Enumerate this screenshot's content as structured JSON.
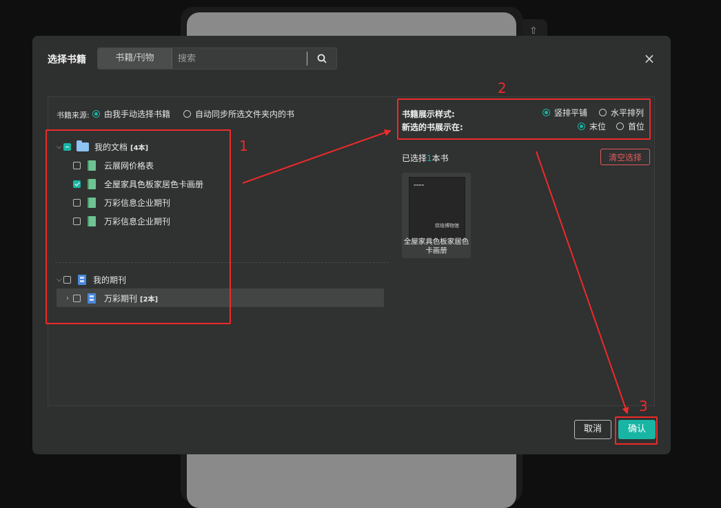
{
  "dialog": {
    "title": "选择书籍",
    "search_type": "书籍/刊物",
    "search_placeholder": "搜索",
    "search_icon": "search-icon",
    "close_icon": "close-icon"
  },
  "source": {
    "label": "书籍来源:",
    "options": [
      "由我手动选择书籍",
      "自动同步所选文件夹内的书"
    ],
    "selected": 0
  },
  "tree": {
    "docs_folder": {
      "label": "我的文档",
      "count": "[4本]"
    },
    "docs": [
      {
        "label": "云展网价格表",
        "checked": false
      },
      {
        "label": "全屋家具色板家居色卡画册",
        "checked": true
      },
      {
        "label": "万彩信息企业期刊",
        "checked": false
      },
      {
        "label": "万彩信息企业期刊",
        "checked": false
      }
    ],
    "periodicals_folder": {
      "label": "我的期刊"
    },
    "periodical": {
      "label": "万彩期刊",
      "count": "[2本]"
    }
  },
  "display": {
    "style_label": "书籍展示样式:",
    "style_options": [
      "竖排平铺",
      "水平排列"
    ],
    "position_label": "新选的书展示在:",
    "position_options": [
      "末位",
      "首位"
    ]
  },
  "selection": {
    "prefix": "已选择",
    "count": "1",
    "suffix": "本书",
    "clear_label": "清空选择",
    "book_title": "全屋家具色板家居色卡画册",
    "cover_title": "烘焙博物馆"
  },
  "footer": {
    "cancel": "取消",
    "confirm": "确认"
  },
  "annotations": {
    "n1": "1",
    "n2": "2",
    "n3": "3"
  },
  "colors": {
    "accent": "#19b5a4",
    "annotation": "#f02a2a",
    "danger": "#e05b5b",
    "dialog_bg": "#2e2f2f"
  }
}
